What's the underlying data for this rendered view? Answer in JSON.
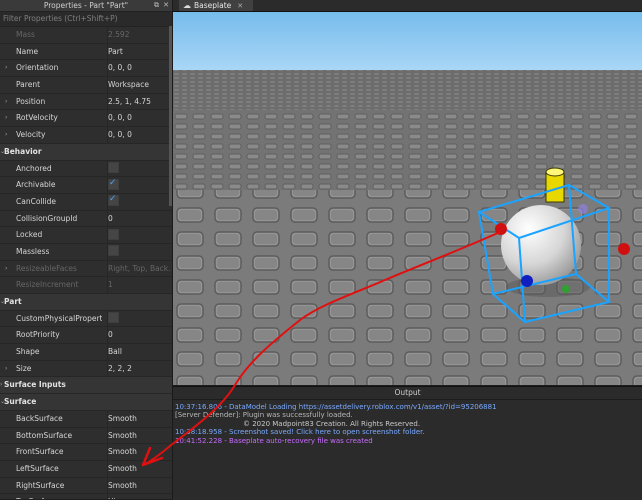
{
  "props_panel": {
    "title": "Properties - Part \"Part\"",
    "filter_placeholder": "Filter Properties (Ctrl+Shift+P)",
    "rows": [
      {
        "name": "Mass",
        "value": "2.592",
        "type": "text",
        "dim": true
      },
      {
        "name": "Name",
        "value": "Part",
        "type": "text"
      },
      {
        "name": "Orientation",
        "value": "0, 0, 0",
        "type": "text",
        "expand": true
      },
      {
        "name": "Parent",
        "value": "Workspace",
        "type": "text"
      },
      {
        "name": "Position",
        "value": "2.5, 1, 4.75",
        "type": "text",
        "expand": true
      },
      {
        "name": "RotVelocity",
        "value": "0, 0, 0",
        "type": "text",
        "expand": true
      },
      {
        "name": "Velocity",
        "value": "0, 0, 0",
        "type": "text",
        "expand": true
      },
      {
        "name": "Behavior",
        "type": "category"
      },
      {
        "name": "Anchored",
        "type": "checkbox",
        "checked": false
      },
      {
        "name": "Archivable",
        "type": "checkbox",
        "checked": true
      },
      {
        "name": "CanCollide",
        "type": "checkbox",
        "checked": true
      },
      {
        "name": "CollisionGroupId",
        "value": "0",
        "type": "text"
      },
      {
        "name": "Locked",
        "type": "checkbox",
        "checked": false
      },
      {
        "name": "Massless",
        "type": "checkbox",
        "checked": false
      },
      {
        "name": "ResizeableFaces",
        "value": "Right, Top, Back...",
        "type": "text",
        "dim": true,
        "expand": true
      },
      {
        "name": "ResizeIncrement",
        "value": "1",
        "type": "text",
        "dim": true
      },
      {
        "name": "Part",
        "type": "category"
      },
      {
        "name": "CustomPhysicalProperties",
        "type": "checkbox",
        "checked": false
      },
      {
        "name": "RootPriority",
        "value": "0",
        "type": "text"
      },
      {
        "name": "Shape",
        "value": "Ball",
        "type": "text"
      },
      {
        "name": "Size",
        "value": "2, 2, 2",
        "type": "text",
        "expand": true
      },
      {
        "name": "Surface Inputs",
        "type": "category",
        "collapsed": true
      },
      {
        "name": "Surface",
        "type": "category"
      },
      {
        "name": "BackSurface",
        "value": "Smooth",
        "type": "text"
      },
      {
        "name": "BottomSurface",
        "value": "Smooth",
        "type": "text"
      },
      {
        "name": "FrontSurface",
        "value": "Smooth",
        "type": "text"
      },
      {
        "name": "LeftSurface",
        "value": "Smooth",
        "type": "text"
      },
      {
        "name": "RightSurface",
        "value": "Smooth",
        "type": "text"
      },
      {
        "name": "TopSurface",
        "value": "Hinge",
        "type": "text"
      }
    ]
  },
  "tab": {
    "label": "Baseplate",
    "icon": "cloud-icon"
  },
  "output": {
    "title": "Output",
    "lines": [
      {
        "text": "10:37:16.806 - DataModel Loading https://assetdelivery.roblox.com/v1/asset/?id=95206881",
        "color": "#79a9ff"
      },
      {
        "text": "[Server Defender]: Plugin was successfully loaded.",
        "color": "#b7b7b7"
      },
      {
        "text": "© 2020 Madpoint83 Creation. All Rights Reserved.",
        "color": "#c9c9c9",
        "indent": true
      },
      {
        "text": "10:38:18.958 - Screenshot saved! Click here to open screenshot folder.",
        "color": "#79a9ff"
      },
      {
        "text": "10:41:52.228 - Baseplate auto-recovery file was created",
        "color": "#c86cff"
      }
    ]
  },
  "colors": {
    "selection_box": "#1aa3ff",
    "annotation_arrow": "#e01010",
    "hinge": "#f0e000"
  }
}
